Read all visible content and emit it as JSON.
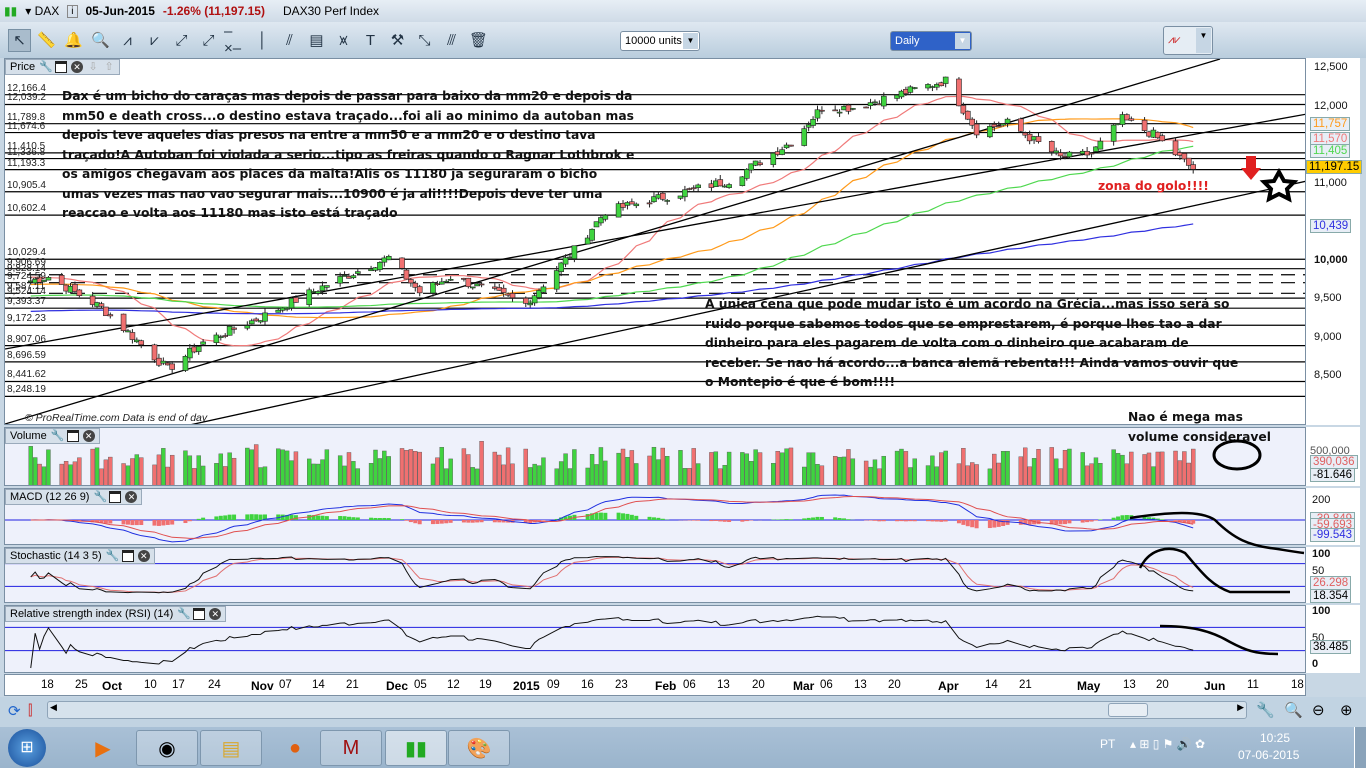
{
  "titlebar": {
    "symbol": "DAX",
    "date": "05-Jun-2015",
    "change": "-1.26% (11,197.15)",
    "name": "DAX30 Perf Index"
  },
  "toolbar": {
    "units": "10000 units",
    "period": "Daily",
    "tools": [
      "pointer-icon",
      "ruler-icon",
      "alarm-bell-icon",
      "magnifier-icon",
      "triangle-pattern-icon",
      "channel-icon",
      "segment-icon",
      "line-icon",
      "horizontal-line-icon",
      "vertical-line-icon",
      "parallel-lines-icon",
      "fibonacci-icon",
      "regression-icon",
      "text-icon",
      "tools-icon",
      "points-icon",
      "ray-icon",
      "trash-icon"
    ]
  },
  "price_panel": {
    "title": "Price",
    "levels": [
      "12,166.4",
      "12,039.2",
      "11,789.8",
      "11,674.6",
      "11,410.5",
      "11,336.8",
      "11,193.3",
      "10,905.4",
      "10,602.4",
      "10,029.4",
      "9,906.69",
      "9,828.14",
      "9,724.59",
      "9,587.11",
      "9,524.14",
      "9,393.37",
      "9,172.23",
      "8,907.06",
      "8,696.59",
      "8,441.62",
      "8,248.19"
    ],
    "axis": [
      "12,500",
      "12,000",
      "11,000",
      "10,000",
      "9,500",
      "9,000",
      "8,500"
    ],
    "tags": {
      "mm50": "11,757",
      "mm20": "11,570",
      "mm100": "11,405",
      "last": "11,197.15",
      "mm200": "10,439"
    },
    "copyright": "© ProRealTime.com  Data is end of day",
    "note1": "Dax é um bicho do caraças mas depois de passar para baixo da mm20 e depois da mm50 e death cross...o destino estava traçado...foi ali ao minimo da autoban mas depois teve aqueles dias presos na entre a mm50 e a mm20 e o destino tava traçado!A Autoban foi violada a serio...tipo as freiras quando o Ragnar Lothbrok e os amigos chegavam aos places da malta!Alis os 11180 ja seguraram o bicho umas vezes mas nao vao segurar mais...10900 é ja ali!!!!Depois deve ter uma reaccao e volta aos 11180 mas isto está traçado",
    "note2": "A única cena que pode mudar isto é um acordo na Grécia...mas isso será so ruido porque sabemos todos que se emprestarem, é porque lhes tao a dar dinheiro para eles pagarem de volta com o dinheiro que acabaram de receber. Se nao há acordo...a banca alemã rebenta!!! Ainda vamos ouvir que o Montepio é que é bom!!!!",
    "note3": "zona do golo!!!!",
    "price_path": [
      [
        "2014-09-15",
        9750
      ],
      [
        "2014-09-19",
        9800
      ],
      [
        "2014-10-01",
        9400
      ],
      [
        "2014-10-16",
        8600
      ],
      [
        "2014-10-24",
        8950
      ],
      [
        "2014-11-07",
        9300
      ],
      [
        "2014-11-21",
        9700
      ],
      [
        "2014-12-05",
        10050
      ],
      [
        "2014-12-12",
        9600
      ],
      [
        "2014-12-19",
        9800
      ],
      [
        "2015-01-05",
        9450
      ],
      [
        "2015-01-16",
        10150
      ],
      [
        "2015-01-23",
        10650
      ],
      [
        "2015-02-06",
        10850
      ],
      [
        "2015-02-20",
        11050
      ],
      [
        "2015-03-06",
        11550
      ],
      [
        "2015-03-13",
        12000
      ],
      [
        "2015-03-20",
        12000
      ],
      [
        "2015-04-10",
        12350
      ],
      [
        "2015-04-17",
        11700
      ],
      [
        "2015-04-24",
        11800
      ],
      [
        "2015-05-06",
        11350
      ],
      [
        "2015-05-13",
        11400
      ],
      [
        "2015-05-20",
        11850
      ],
      [
        "2015-05-27",
        11650
      ],
      [
        "2015-06-05",
        11197.15
      ]
    ]
  },
  "volume_panel": {
    "title": "Volume",
    "tags": [
      "390,036",
      "-81.646"
    ],
    "axis_top": "500,000",
    "note": "Nao é mega mas volume consideravel"
  },
  "macd_panel": {
    "title": "MACD (12 26 9)",
    "axis": [
      "200"
    ],
    "tags": [
      "-39.849",
      "-59.693",
      "-99.543"
    ]
  },
  "stoch_panel": {
    "title": "Stochastic (14 3 5)",
    "axis": [
      "100",
      "50"
    ],
    "tags": [
      "26.298",
      "18.354"
    ]
  },
  "rsi_panel": {
    "title": "Relative strength index (RSI) (14)",
    "axis": [
      "100",
      "50",
      "0"
    ],
    "tags": [
      "38.485"
    ]
  },
  "dates": [
    "18",
    "25",
    "Oct",
    "10",
    "17",
    "24",
    "Nov",
    "07",
    "14",
    "21",
    "Dec",
    "05",
    "12",
    "19",
    "2015",
    "09",
    "16",
    "23",
    "Feb",
    "06",
    "13",
    "20",
    "Mar",
    "06",
    "13",
    "20",
    "Apr",
    "14",
    "21",
    "May",
    "13",
    "20",
    "Jun",
    "11",
    "18"
  ],
  "taskbar": {
    "lang": "PT",
    "time": "10:25",
    "date": "07-06-2015"
  },
  "colors": {
    "up": "#3fd33f",
    "down": "#f07070",
    "mm20": "#f07a7a",
    "mm50": "#ff9a1a",
    "mm100": "#4fd84f",
    "mm200": "#3030e0",
    "annotation": "#e02020"
  }
}
